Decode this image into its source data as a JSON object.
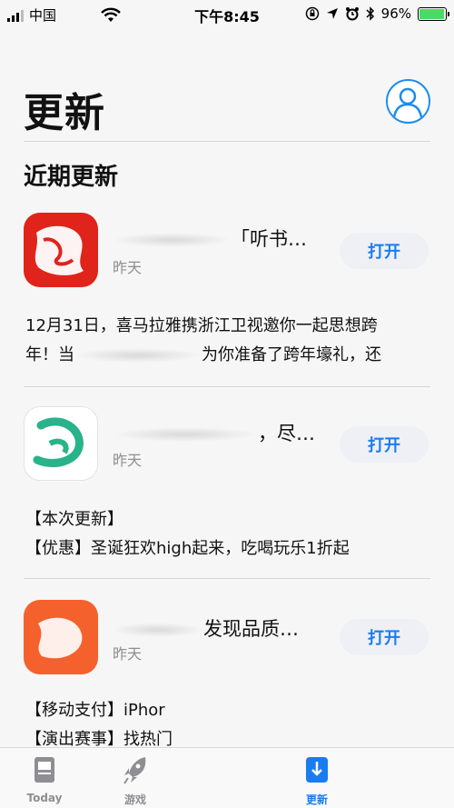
{
  "status_bar": {
    "carrier": "中国",
    "time": "下午8:45",
    "battery": "96%",
    "battery_level": 0.96
  },
  "header": {
    "title": "更新",
    "account_icon": "person-circle-icon"
  },
  "section": {
    "title": "近期更新"
  },
  "apps": [
    {
      "name": "「听书…",
      "date": "昨天",
      "button": "打开",
      "notes": [
        "12月31日，喜马拉雅携浙江卫视邀你一起思想跨",
        "年！当",
        "为你准备了跨年壕礼，还"
      ],
      "icon_color": "#e0231b"
    },
    {
      "name": "，尽…",
      "date": "昨天",
      "button": "打开",
      "notes": [
        "【本次更新】",
        "【优惠】圣诞狂欢high起来，吃喝玩乐1折起"
      ],
      "icon_color": "#29b38b"
    },
    {
      "name": "发现品质…",
      "date": "昨天",
      "button": "打开",
      "notes": [
        "【移动支付】iPhor",
        "【演出赛事】找热门"
      ],
      "icon_color": "#f5612c"
    }
  ],
  "tab_bar": {
    "tabs": [
      {
        "label": "Today",
        "icon": "today-icon"
      },
      {
        "label": "游戏",
        "icon": "rocket-icon"
      },
      {
        "label": "更新",
        "icon": "updates-download-icon"
      }
    ],
    "accent": "#1a7cf0"
  }
}
